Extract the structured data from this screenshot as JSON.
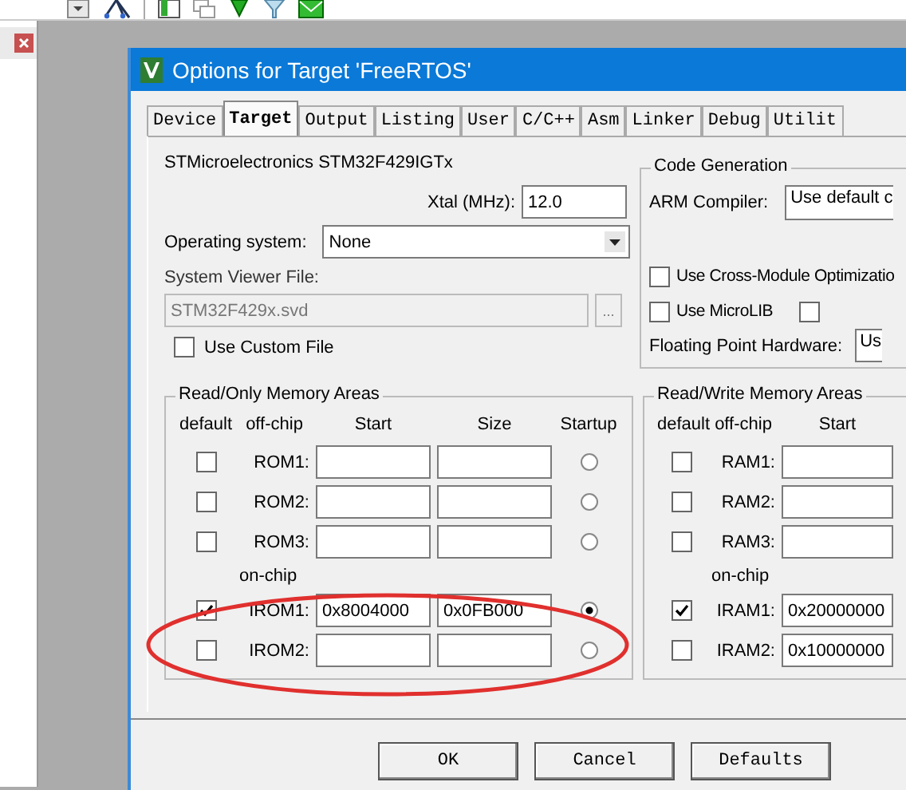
{
  "dialog": {
    "title": "Options for Target 'FreeRTOS'"
  },
  "tabs": [
    {
      "label": "Device",
      "selected": false
    },
    {
      "label": "Target",
      "selected": true
    },
    {
      "label": "Output",
      "selected": false
    },
    {
      "label": "Listing",
      "selected": false
    },
    {
      "label": "User",
      "selected": false
    },
    {
      "label": "C/C++",
      "selected": false
    },
    {
      "label": "Asm",
      "selected": false
    },
    {
      "label": "Linker",
      "selected": false
    },
    {
      "label": "Debug",
      "selected": false
    },
    {
      "label": "Utilit",
      "selected": false
    }
  ],
  "device": "STMicroelectronics STM32F429IGTx",
  "xtal": {
    "label": "Xtal (MHz):",
    "value": "12.0"
  },
  "operating_system": {
    "label": "Operating system:",
    "value": "None"
  },
  "system_viewer_file": {
    "label": "System Viewer File:",
    "value": "STM32F429x.svd",
    "disabled": true,
    "browse_button": "..."
  },
  "use_custom_file": {
    "label": "Use Custom File",
    "checked": false
  },
  "code_generation": {
    "title": "Code Generation",
    "arm_compiler_label": "ARM Compiler:",
    "arm_compiler_value": "Use default c",
    "options": [
      {
        "label": "Use Cross-Module Optimizatio",
        "checked": false
      },
      {
        "label": "Use MicroLIB",
        "checked": false
      }
    ],
    "extra_checkbox": {
      "checked": false
    },
    "floating_point_label": "Floating Point Hardware:",
    "floating_point_value": "Us"
  },
  "rom_areas": {
    "title": "Read/Only Memory Areas",
    "columns": [
      "default",
      "off-chip",
      "Start",
      "Size",
      "Startup"
    ],
    "on_chip_label": "on-chip",
    "off_chip_rows": [
      {
        "name": "ROM1:",
        "default": false,
        "startup": false
      },
      {
        "name": "ROM2:",
        "default": false,
        "startup": false
      },
      {
        "name": "ROM3:",
        "default": false,
        "startup": false
      }
    ],
    "on_chip_rows": [
      {
        "name": "IROM1:",
        "default": true,
        "start": "0x8004000",
        "size": "0x0FB000",
        "startup": true
      },
      {
        "name": "IROM2:",
        "default": false,
        "startup": false
      }
    ]
  },
  "ram_areas": {
    "title": "Read/Write Memory Areas",
    "columns": [
      "default",
      "off-chip",
      "Start"
    ],
    "on_chip_label": "on-chip",
    "off_chip_rows": [
      {
        "name": "RAM1:",
        "default": false
      },
      {
        "name": "RAM2:",
        "default": false
      },
      {
        "name": "RAM3:",
        "default": false
      }
    ],
    "on_chip_rows": [
      {
        "name": "IRAM1:",
        "default": true,
        "start": "0x20000000"
      },
      {
        "name": "IRAM2:",
        "default": false,
        "start": "0x10000000"
      }
    ]
  },
  "buttons": [
    "OK",
    "Cancel",
    "Defaults"
  ],
  "annotation": {
    "kind": "ellipse",
    "color": "#e0302e"
  }
}
